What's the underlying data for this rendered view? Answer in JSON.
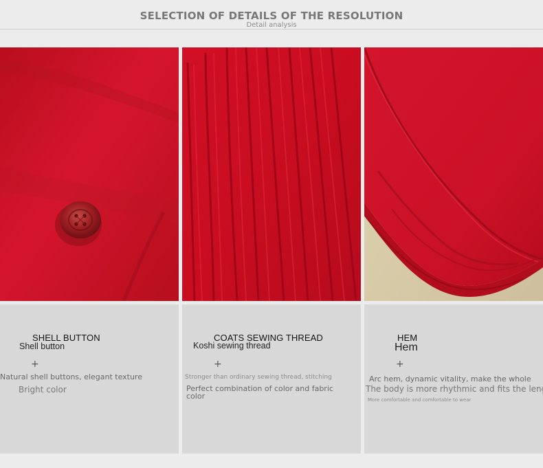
{
  "header": {
    "title": "SELECTION OF DETAILS OF THE RESOLUTION",
    "subtitle": "Detail analysis"
  },
  "details": [
    {
      "title_en_upper": "SHELL BUTTON",
      "title_en": "Shell button",
      "plus": "+",
      "description_1": "Natural shell buttons, elegant texture",
      "description_2": "Bright color"
    },
    {
      "title_en_upper": "COATS SEWING THREAD",
      "title_en": "Koshi sewing thread",
      "plus": "+",
      "description_1": "Stronger than ordinary sewing thread, stitching",
      "description_2": "Perfect combination of color and fabric color"
    },
    {
      "title_en_upper": "HEM",
      "title_en": "Hem",
      "plus": "+",
      "description_1": "Arc hem, dynamic vitality, make the whole",
      "description_2": "The body is more rhythmic and fits the length,",
      "description_3": "More comfortable and comfortable to wear"
    }
  ],
  "colors": {
    "background": "#ececec",
    "panel": "#d8d8d8",
    "fabric_red": "#d2112a"
  }
}
